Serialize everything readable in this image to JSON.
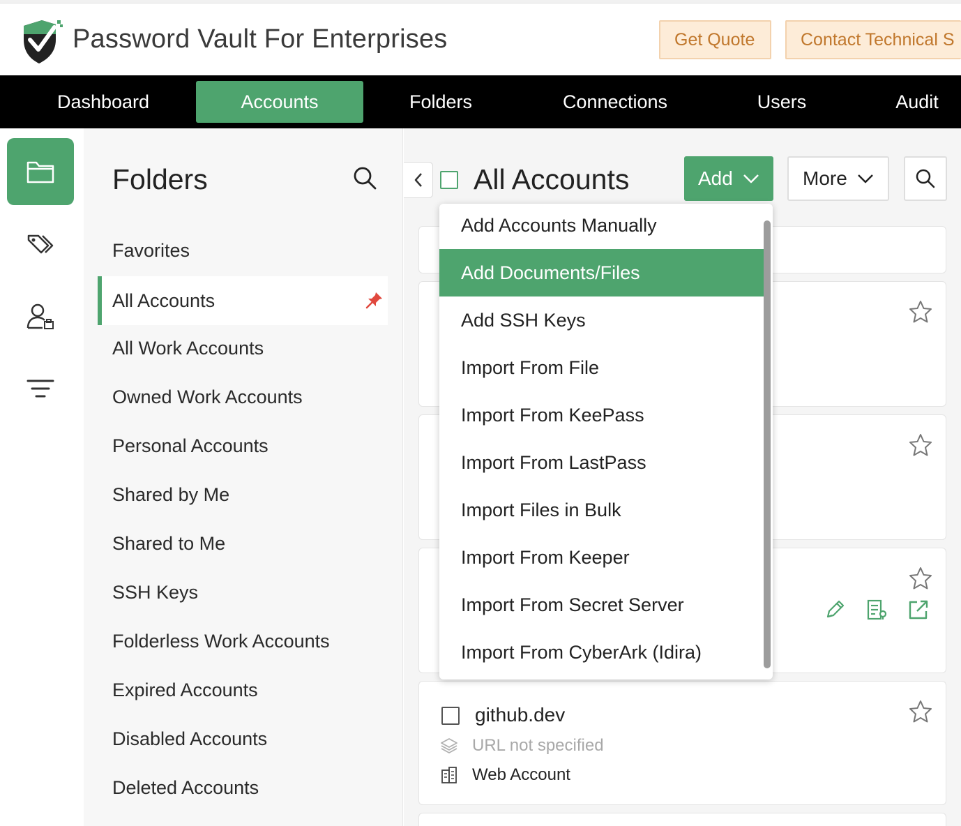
{
  "header": {
    "app_title": "Password Vault For Enterprises",
    "get_quote_label": "Get Quote",
    "contact_label": "Contact Technical S",
    "brand_color": "#4ea46e",
    "accent_button_color": "#fdecd8"
  },
  "nav": {
    "items": [
      "Dashboard",
      "Accounts",
      "Folders",
      "Connections",
      "Users",
      "Audit"
    ],
    "active": "Accounts"
  },
  "rail": {
    "icons": [
      "folder-icon",
      "tags-icon",
      "user-group-icon",
      "filter-icon"
    ]
  },
  "folders": {
    "title": "Folders",
    "items": [
      "Favorites",
      "All Accounts",
      "All Work Accounts",
      "Owned Work Accounts",
      "Personal Accounts",
      "Shared by Me",
      "Shared to Me",
      "SSH Keys",
      "Folderless Work Accounts",
      "Expired Accounts",
      "Disabled Accounts",
      "Deleted Accounts"
    ],
    "active": "All Accounts"
  },
  "main": {
    "title": "All Accounts",
    "add_label": "Add",
    "more_label": "More"
  },
  "add_menu": {
    "items": [
      "Add Accounts Manually",
      "Add Documents/Files",
      "Add SSH Keys",
      "Import From File",
      "Import From KeePass",
      "Import From LastPass",
      "Import Files in Bulk",
      "Import From Keeper",
      "Import From Secret Server",
      "Import From CyberArk (Idira)"
    ],
    "highlighted": "Add Documents/Files"
  },
  "account_card": {
    "name": "github.dev",
    "url": "URL not specified",
    "type": "Web Account"
  }
}
